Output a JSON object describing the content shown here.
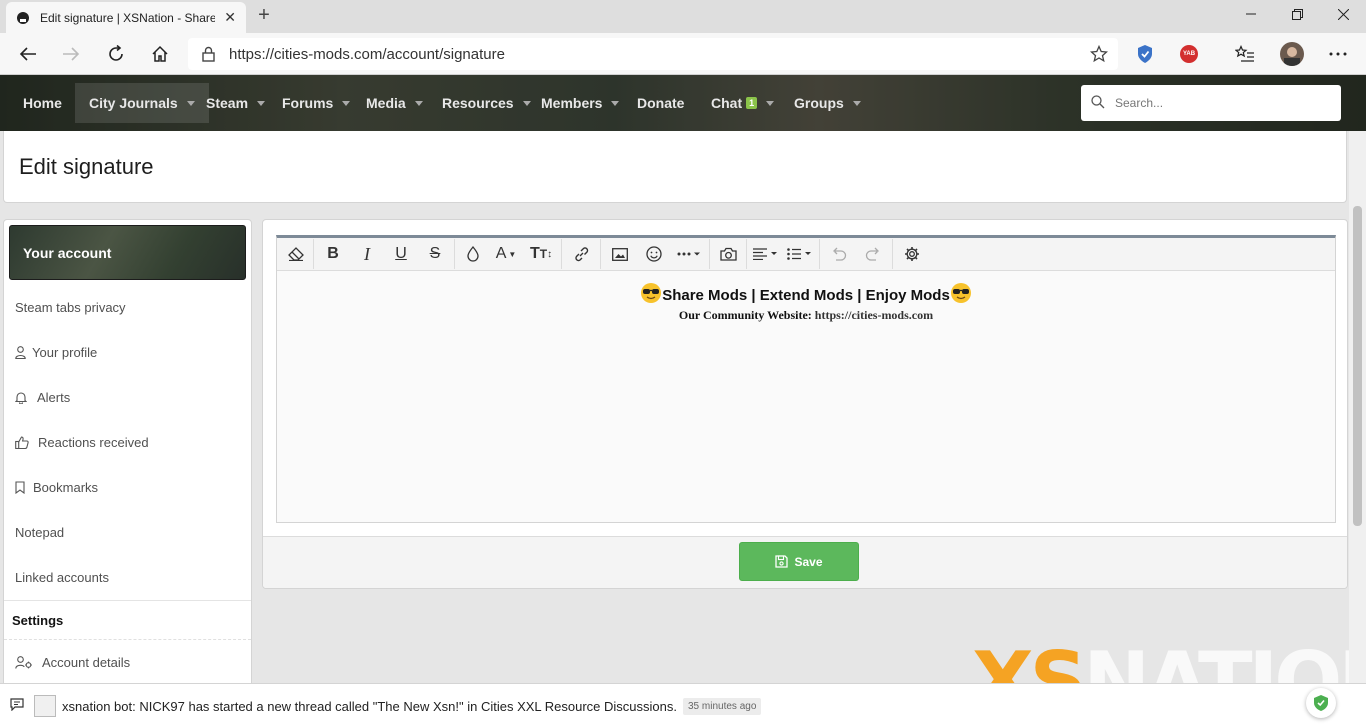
{
  "browser": {
    "tab_title": "Edit signature | XSNation - Share",
    "url": "https://cities-mods.com/account/signature",
    "ext_badge": "YAB"
  },
  "nav": {
    "items": [
      {
        "label": "Home"
      },
      {
        "label": "City Journals"
      },
      {
        "label": "Steam"
      },
      {
        "label": "Forums"
      },
      {
        "label": "Media"
      },
      {
        "label": "Resources"
      },
      {
        "label": "Members"
      },
      {
        "label": "Donate"
      },
      {
        "label": "Chat",
        "badge": "1"
      },
      {
        "label": "Groups"
      }
    ],
    "search_placeholder": "Search..."
  },
  "page": {
    "title": "Edit signature"
  },
  "sidebar": {
    "header": "Your account",
    "items": [
      {
        "label": "Steam tabs privacy"
      },
      {
        "label": "Your profile"
      },
      {
        "label": "Alerts"
      },
      {
        "label": "Reactions received"
      },
      {
        "label": "Bookmarks"
      },
      {
        "label": "Notepad"
      },
      {
        "label": "Linked accounts"
      }
    ],
    "section": "Settings",
    "section_items": [
      {
        "label": "Account details"
      }
    ]
  },
  "editor": {
    "line1": "Share Mods | Extend Mods | Enjoy Mods",
    "line2_label": "Our Community Website:",
    "line2_link": "https://cities-mods.com",
    "save_label": "Save"
  },
  "watermark": {
    "xs": "XS",
    "nation": "NATION"
  },
  "notification": {
    "text": "xsnation bot: NICK97 has started a new thread called \"The New Xsn!\" in Cities XXL Resource Discussions.",
    "time": "35 minutes ago"
  }
}
